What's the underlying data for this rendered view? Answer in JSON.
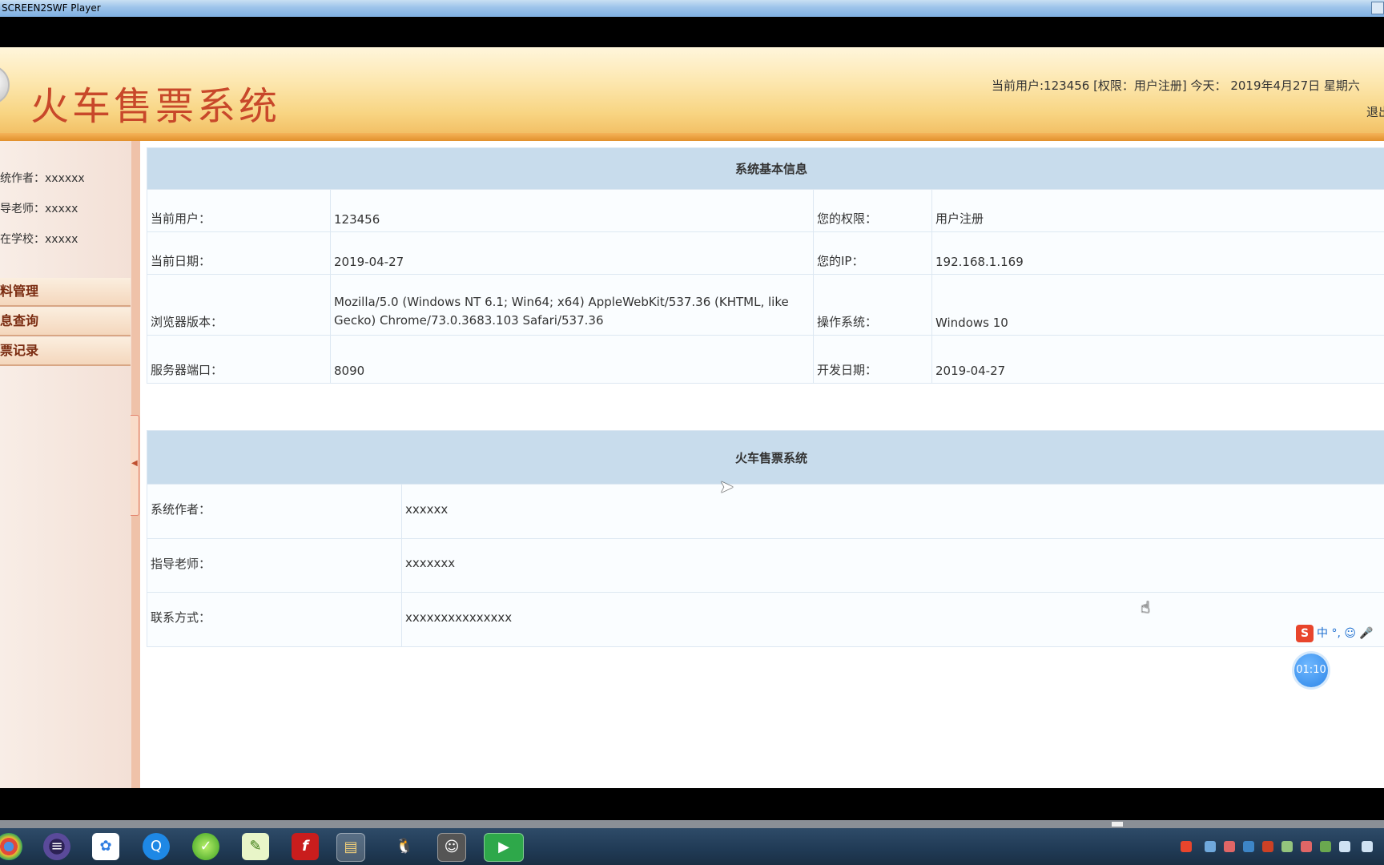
{
  "window": {
    "title": "SCREEN2SWF Player"
  },
  "header": {
    "app_title": "火车售票系统",
    "user_info": "当前用户:123456 [权限：用户注册] 今天： 2019年4月27日 星期六",
    "logout": "退出"
  },
  "sidebar": {
    "info": [
      {
        "label": "统作者：xxxxxx"
      },
      {
        "label": "导老师：xxxxx"
      },
      {
        "label": "在学校：xxxxx"
      }
    ],
    "menu": [
      {
        "label": "料管理"
      },
      {
        "label": "息查询"
      },
      {
        "label": "票记录"
      }
    ],
    "collapse_glyph": "◀"
  },
  "system_info": {
    "title": "系统基本信息",
    "rows": [
      {
        "label1": "当前用户：",
        "value1": "123456",
        "label2": "您的权限：",
        "value2": "用户注册"
      },
      {
        "label1": "当前日期：",
        "value1": "2019-04-27",
        "label2": "您的IP：",
        "value2": "192.168.1.169"
      },
      {
        "label1": "浏览器版本：",
        "value1": "Mozilla/5.0 (Windows NT 6.1; Win64; x64) AppleWebKit/537.36 (KHTML, like Gecko) Chrome/73.0.3683.103 Safari/537.36",
        "label2": "操作系统：",
        "value2": "Windows 10"
      },
      {
        "label1": "服务器端口：",
        "value1": "8090",
        "label2": "开发日期：",
        "value2": "2019-04-27"
      }
    ]
  },
  "about": {
    "title": "火车售票系统",
    "rows": [
      {
        "label": "系统作者：",
        "value": "xxxxxx"
      },
      {
        "label": "指导老师：",
        "value": "xxxxxxx"
      },
      {
        "label": "联系方式：",
        "value": "xxxxxxxxxxxxxxx"
      }
    ]
  },
  "ime": {
    "logo": "S",
    "mode": "中 °, ☺ 🎤"
  },
  "recording_timer": "01:10",
  "taskbar": {
    "icons": [
      "chrome-icon",
      "eclipse-icon",
      "baidu-netdisk-icon",
      "qq-browser-icon",
      "360-icon",
      "notepad-icon",
      "flash-icon",
      "file-explorer-icon",
      "qq-icon",
      "user-photo-icon",
      "screen2swf-icon"
    ]
  }
}
